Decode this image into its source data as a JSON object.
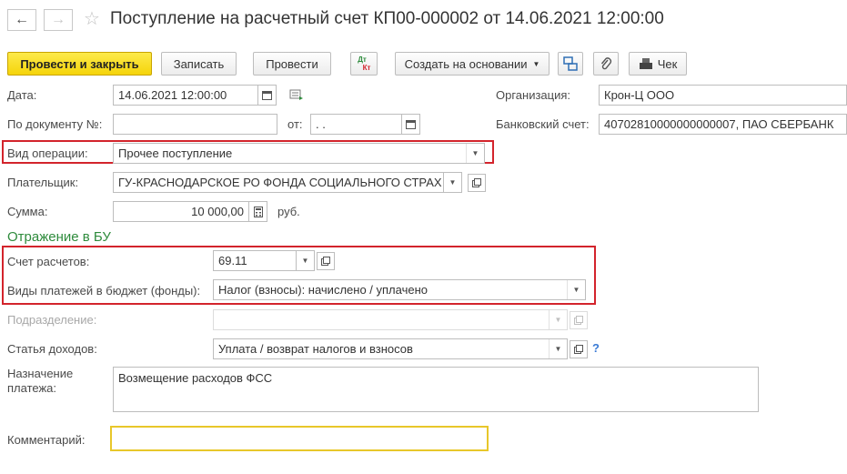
{
  "header": {
    "title": "Поступление на расчетный счет КП00-000002 от 14.06.2021 12:00:00"
  },
  "toolbar": {
    "post_close": "Провести и закрыть",
    "save": "Записать",
    "post": "Провести",
    "dt_kt_top": "Дт",
    "dt_kt_bottom": "Кт",
    "create_based": "Создать на основании",
    "receipt": "Чек"
  },
  "form": {
    "date_label": "Дата:",
    "date_value": "14.06.2021 12:00:00",
    "doc_label": "По документу №:",
    "doc_value": "",
    "from_label": "от:",
    "from_value": ". .",
    "org_label": "Организация:",
    "org_value": "Крон-Ц ООО",
    "bank_label": "Банковский счет:",
    "bank_value": "40702810000000000007, ПАО СБЕРБАНК",
    "optype_label": "Вид операции:",
    "optype_value": "Прочее поступление",
    "payer_label": "Плательщик:",
    "payer_value": "ГУ-КРАСНОДАРСКОЕ РО ФОНДА СОЦИАЛЬНОГО СТРАХ",
    "sum_label": "Сумма:",
    "sum_value": "10 000,00",
    "currency": "руб.",
    "section_title": "Отражение в БУ",
    "account_label": "Счет расчетов:",
    "account_value": "69.11",
    "budget_label": "Виды платежей в бюджет (фонды):",
    "budget_value": "Налог (взносы): начислено / уплачено",
    "dept_label": "Подразделение:",
    "dept_value": "",
    "income_label": "Статья доходов:",
    "income_value": "Уплата / возврат налогов и взносов",
    "help": "?",
    "purpose_label_1": "Назначение",
    "purpose_label_2": "платежа:",
    "purpose_value": "Возмещение расходов ФСС",
    "comment_label": "Комментарий:",
    "comment_value": ""
  },
  "colors": {
    "primary_button": "#f5d40a",
    "highlight_box": "#d3242c",
    "section_title": "#2e8b3c",
    "comment_border": "#e8c72a"
  }
}
